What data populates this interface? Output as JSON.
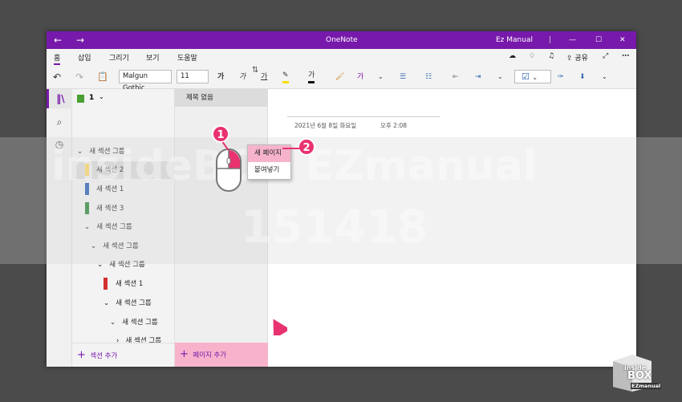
{
  "window": {
    "back": "←",
    "forward": "→",
    "app_title": "OneNote",
    "account": "Ez Manual",
    "minimize": "—",
    "maximize": "☐",
    "close": "✕"
  },
  "ribbon_tabs": [
    "홈",
    "삽입",
    "그리기",
    "보기",
    "도움말"
  ],
  "ribbon_right": {
    "share_label": "공유"
  },
  "toolbar": {
    "font_name": "Malgun Gothic",
    "font_size": "11",
    "bold": "가",
    "italic": "가",
    "underline": "가",
    "font_color": "가",
    "style": "가"
  },
  "notebook": {
    "label": "1"
  },
  "sections": {
    "group_top": "새 섹션 그룹",
    "item1": "새 섹션 2",
    "item2": "새 섹션 1",
    "item3": "새 섹션 3",
    "group2": "새 섹션 그룹",
    "group3": "새 섹션 그룹",
    "group4": "새 섹션 그룹",
    "item4": "새 섹션 1",
    "group5": "새 섹션 그룹",
    "group6": "새 섹션 그룹",
    "group7": "새 섹션 그룹"
  },
  "pages": {
    "item1": "제목 없음"
  },
  "canvas": {
    "date": "2021년 6월 8일 화요일",
    "time": "오후 2:08"
  },
  "context_menu": {
    "new_page": "새 페이지",
    "paste": "붙여넣기"
  },
  "bottom": {
    "add_section": "섹션 추가",
    "add_page": "페이지 추가",
    "plus": "+"
  },
  "badges": {
    "b1": "1",
    "b2": "2"
  },
  "watermark": {
    "line1": "insideBOX EZmanual",
    "line2": "151418"
  },
  "logo": {
    "inside": "inside",
    "box": "BOX",
    "ez": "EZmanual"
  },
  "colors": {
    "accent": "#7719aa",
    "highlight_pink": "#f7b3cc",
    "badge": "#e8336f"
  }
}
